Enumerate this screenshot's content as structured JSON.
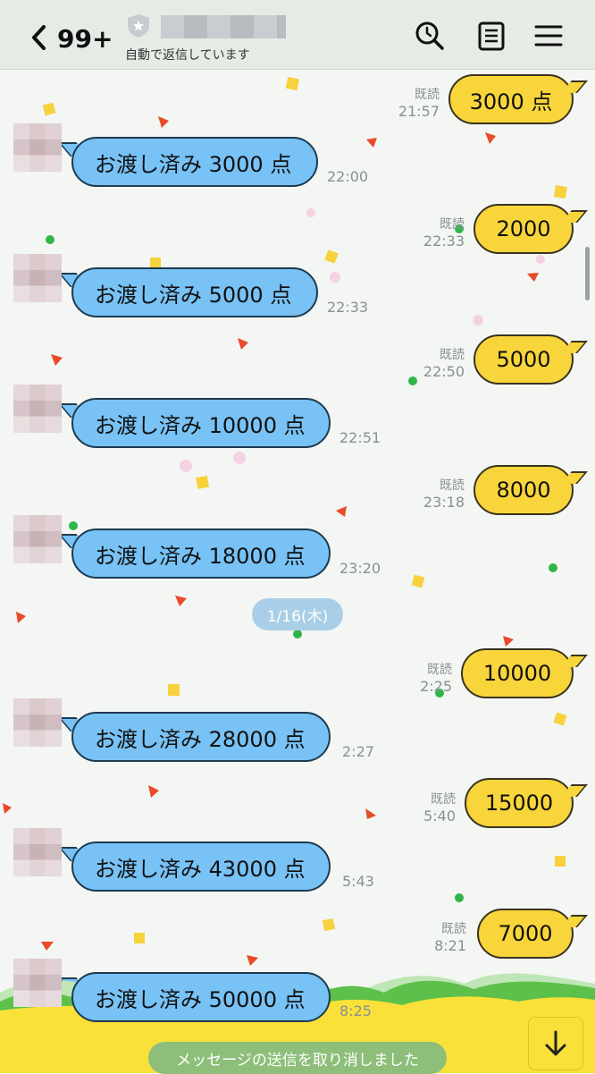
{
  "header": {
    "unread_count": "99+",
    "auto_reply_status": "自動で返信しています",
    "icons": [
      "back-icon",
      "shield-icon",
      "search-icon",
      "note-icon",
      "menu-icon"
    ]
  },
  "messages": [
    {
      "direction": "out",
      "text": "3000 点",
      "read": "既読",
      "time": "21:57"
    },
    {
      "direction": "in",
      "text": "お渡し済み 3000 点",
      "time": "22:00"
    },
    {
      "direction": "out",
      "text": "2000",
      "read": "既読",
      "time": "22:33"
    },
    {
      "direction": "in",
      "text": "お渡し済み 5000 点",
      "time": "22:33"
    },
    {
      "direction": "out",
      "text": "5000",
      "read": "既読",
      "time": "22:50"
    },
    {
      "direction": "in",
      "text": "お渡し済み 10000 点",
      "time": "22:51"
    },
    {
      "direction": "out",
      "text": "8000",
      "read": "既読",
      "time": "23:18"
    },
    {
      "direction": "in",
      "text": "お渡し済み 18000 点",
      "time": "23:20"
    },
    {
      "direction": "out",
      "text": "10000",
      "read": "既読",
      "time": "2:25"
    },
    {
      "direction": "in",
      "text": "お渡し済み 28000 点",
      "time": "2:27"
    },
    {
      "direction": "out",
      "text": "15000",
      "read": "既読",
      "time": "5:40"
    },
    {
      "direction": "in",
      "text": "お渡し済み 43000 点",
      "time": "5:43"
    },
    {
      "direction": "out",
      "text": "7000",
      "read": "既読",
      "time": "8:21"
    },
    {
      "direction": "in",
      "text": "お渡し済み 50000 点",
      "time": "8:25"
    }
  ],
  "date_separator": "1/16(木)",
  "toast": "メッセージの送信を取り消しました",
  "colors": {
    "incoming_bubble": "#78c2f5",
    "outgoing_bubble": "#f8d53a",
    "header_bg": "#e6ebe6",
    "toast_bg": "#8dbf7a",
    "date_pill_bg": "#a9cfe8"
  }
}
